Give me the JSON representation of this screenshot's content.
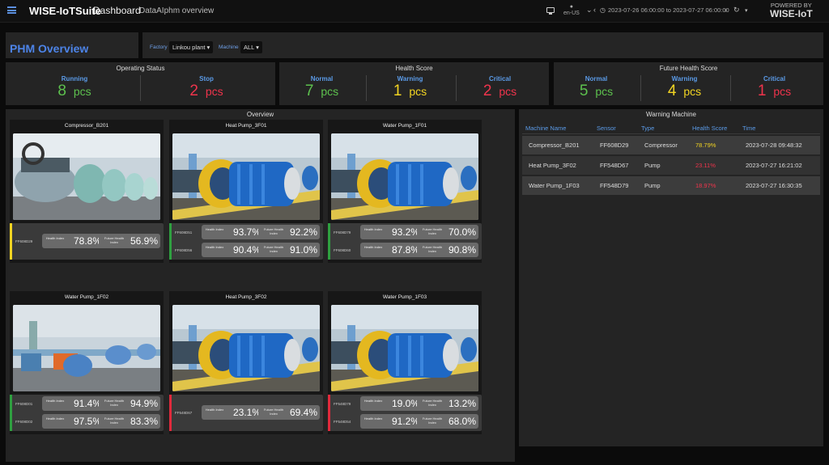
{
  "topbar": {
    "brand": "WISE-IoTSuite",
    "dashboard": "Dashboard",
    "crumb": "DataAIphm overview",
    "lang": "en-US",
    "time_range": "2023-07-26 06:00:00 to 2023-07-27 06:00:00",
    "powered_by": "POWERED BY",
    "powered_brand": "WISE-IoT"
  },
  "title": "PHM Overview",
  "filters": {
    "factory_label": "Factory",
    "factory_value": "Linkou plant",
    "machine_label": "Machine",
    "machine_value": "ALL"
  },
  "unit": "pcs",
  "operating_status": {
    "title": "Operating Status",
    "running_label": "Running",
    "running_value": "8",
    "stop_label": "Stop",
    "stop_value": "2"
  },
  "health_score": {
    "title": "Health Score",
    "normal_label": "Normal",
    "normal_value": "7",
    "warning_label": "Warning",
    "warning_value": "1",
    "critical_label": "Critical",
    "critical_value": "2"
  },
  "future_health_score": {
    "title": "Future Health Score",
    "normal_label": "Normal",
    "normal_value": "5",
    "warning_label": "Warning",
    "warning_value": "4",
    "critical_label": "Critical",
    "critical_value": "1"
  },
  "overview": {
    "title": "Overview",
    "health_label": "Health Index",
    "future_label": "Future Health Index",
    "cards": [
      {
        "name": "Compressor_B201",
        "status_color": "#f2d422",
        "rows": [
          {
            "sensor": "FF608D29",
            "health": "78.8%",
            "future": "56.9%"
          }
        ]
      },
      {
        "name": "Heat Pump_3F01",
        "status_color": "#2fa040",
        "rows": [
          {
            "sensor": "FF608D51",
            "health": "93.7%",
            "future": "92.2%"
          },
          {
            "sensor": "FF608D56",
            "health": "90.4%",
            "future": "91.0%"
          }
        ]
      },
      {
        "name": "Water Pump_1F01",
        "status_color": "#2fa040",
        "rows": [
          {
            "sensor": "FF608D79",
            "health": "93.2%",
            "future": "70.0%"
          },
          {
            "sensor": "FF608D60",
            "health": "87.8%",
            "future": "90.8%"
          }
        ]
      },
      {
        "name": "Water Pump_1F02",
        "status_color": "#2fa040",
        "rows": [
          {
            "sensor": "FF608D01",
            "health": "91.4%",
            "future": "94.9%"
          },
          {
            "sensor": "FF608D02",
            "health": "97.5%",
            "future": "83.3%"
          }
        ]
      },
      {
        "name": "Heat Pump_3F02",
        "status_color": "#e02a3c",
        "rows": [
          {
            "sensor": "FF548D67",
            "health": "23.1%",
            "future": "69.4%"
          }
        ]
      },
      {
        "name": "Water Pump_1F03",
        "status_color": "#e02a3c",
        "rows": [
          {
            "sensor": "FF548D79",
            "health": "19.0%",
            "future": "13.2%"
          },
          {
            "sensor": "FF548D54",
            "health": "91.2%",
            "future": "68.0%"
          }
        ]
      }
    ]
  },
  "warning_machine": {
    "title": "Warning Machine",
    "headers": [
      "Machine Name",
      "Sensor",
      "Type",
      "Health Score",
      "Time"
    ],
    "rows": [
      {
        "name": "Compressor_B201",
        "sensor": "FF608D29",
        "type": "Compressor",
        "score": "78.79%",
        "score_color": "#f2d422",
        "time": "2023-07-28 09:48:32"
      },
      {
        "name": "Heat Pump_3F02",
        "sensor": "FF548D67",
        "type": "Pump",
        "score": "23.11%",
        "score_color": "#f0344c",
        "time": "2023-07-27 16:21:02"
      },
      {
        "name": "Water Pump_1F03",
        "sensor": "FF548D79",
        "type": "Pump",
        "score": "18.97%",
        "score_color": "#f0344c",
        "time": "2023-07-27 16:30:35"
      }
    ]
  }
}
